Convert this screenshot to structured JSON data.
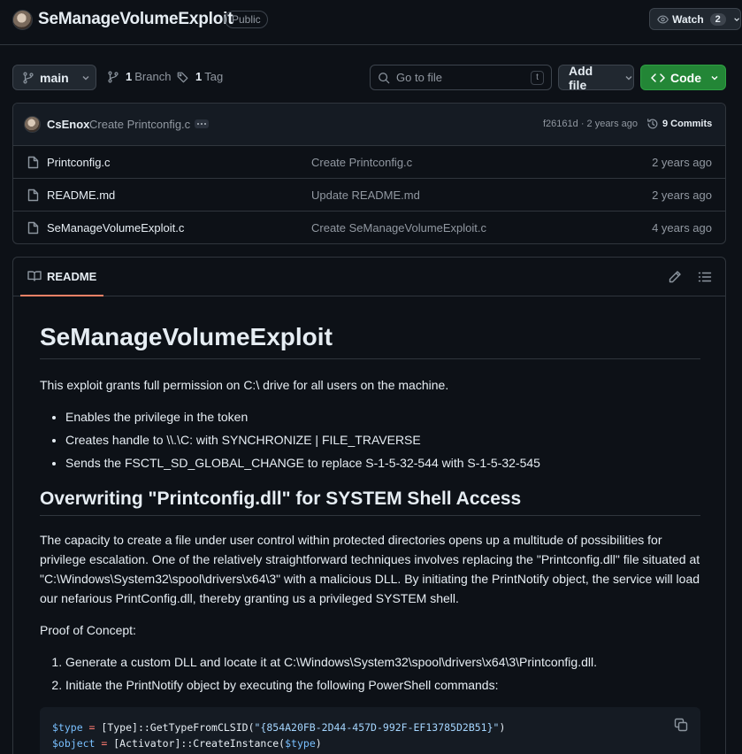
{
  "repo": {
    "name": "SeManageVolumeExploit",
    "visibility": "Public",
    "watch_label": "Watch",
    "watch_count": "2"
  },
  "toolbar": {
    "branch": "main",
    "branch_count": "1",
    "branch_label": "Branch",
    "tag_count": "1",
    "tag_label": "Tag",
    "search_placeholder": "Go to file",
    "search_shortcut": "t",
    "add_file": "Add file",
    "code": "Code"
  },
  "latest_commit": {
    "author": "CsEnox",
    "message": "Create Printconfig.c",
    "meta": "f26161d · 2 years ago",
    "commits_label": "9 Commits"
  },
  "files": [
    {
      "name": "Printconfig.c",
      "commit": "Create Printconfig.c",
      "age": "2 years ago"
    },
    {
      "name": "README.md",
      "commit": "Update README.md",
      "age": "2 years ago"
    },
    {
      "name": "SeManageVolumeExploit.c",
      "commit": "Create SeManageVolumeExploit.c",
      "age": "4 years ago"
    }
  ],
  "readme": {
    "tab_label": "README",
    "title": "SeManageVolumeExploit",
    "intro": "This exploit grants full permission on C:\\ drive for all users on the machine.",
    "bullets": [
      "Enables the privilege in the token",
      "Creates handle to \\\\.\\C: with SYNCHRONIZE | FILE_TRAVERSE",
      "Sends the FSCTL_SD_GLOBAL_CHANGE to replace S-1-5-32-544 with S-1-5-32-545"
    ],
    "section_title": "Overwriting \"Printconfig.dll\" for SYSTEM Shell Access",
    "section_paragraph": "The capacity to create a file under user control within protected directories opens up a multitude of possibilities for privilege escalation. One of the relatively straightforward techniques involves replacing the \"Printconfig.dll\" file situated at \"C:\\Windows\\System32\\spool\\drivers\\x64\\3\" with a malicious DLL. By initiating the PrintNotify object, the service will load our nefarious PrintConfig.dll, thereby granting us a privileged SYSTEM shell.",
    "poc_label": "Proof of Concept:",
    "steps": [
      "Generate a custom DLL and locate it at C:\\Windows\\System32\\spool\\drivers\\x64\\3\\Printconfig.dll.",
      "Initiate the PrintNotify object by executing the following PowerShell commands:"
    ],
    "code": {
      "line1_var": "$type",
      "line1_op": " = ",
      "line1_rest": "[Type]::GetTypeFromCLSID(",
      "line1_str": "\"{854A20FB-2D44-457D-992F-EF13785D2B51}\"",
      "line1_end": ")",
      "line2_var": "$object",
      "line2_op": " = ",
      "line2_rest": "[Activator]::CreateInstance(",
      "line2_arg": "$type",
      "line2_end": ")"
    }
  },
  "colors": {
    "background": "#0d1117",
    "border": "#30363d",
    "code_button": "#238636",
    "tab_underline": "#f78166"
  }
}
